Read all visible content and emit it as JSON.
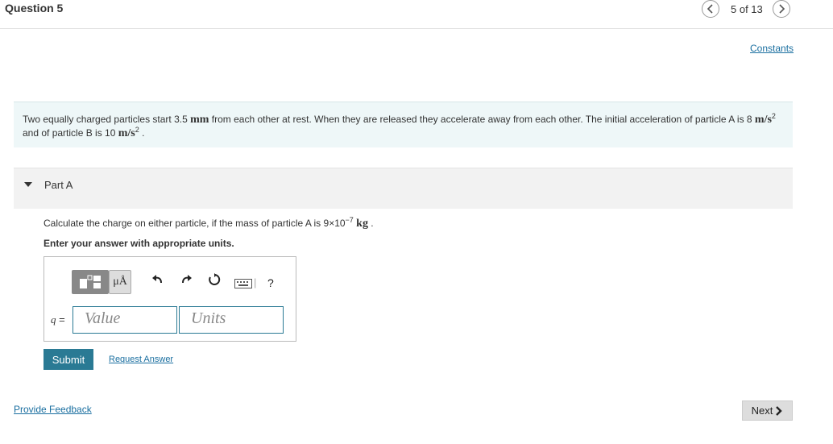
{
  "header": {
    "question_title": "Question 5",
    "position": "5 of 13",
    "prev_icon": "chevron-left-icon",
    "next_icon": "chevron-right-icon"
  },
  "constants_link": "Constants",
  "problem": {
    "text_1": "Two equally charged particles start 3.5 ",
    "unit_mm": "mm",
    "text_2": " from each other at rest. When they are released they accelerate away from each other. The initial acceleration of particle A is 8 ",
    "unit_a1": "m/s",
    "exp_a1": "2",
    "text_3": " and of particle B is 10 ",
    "unit_b1": "m/s",
    "exp_b1": "2",
    "text_4": " ."
  },
  "part": {
    "label": "Part A",
    "question_1": "Calculate the charge on either particle, if the mass of particle A is 9×10",
    "question_exp": "−7",
    "question_unit": "kg",
    "question_end": " .",
    "instruction": "Enter your answer with appropriate units."
  },
  "toolbar": {
    "templates_icon": "templates-icon",
    "units_label": "μÅ",
    "undo_icon": "undo-icon",
    "redo_icon": "redo-icon",
    "reset_icon": "reset-icon",
    "keyboard_icon": "keyboard-icon",
    "help_label": "?"
  },
  "answer": {
    "variable": "q",
    "equals": " =",
    "value_placeholder": "Value",
    "units_placeholder": "Units"
  },
  "actions": {
    "submit": "Submit",
    "request": "Request Answer"
  },
  "footer": {
    "feedback": "Provide Feedback",
    "next": "Next"
  },
  "colors": {
    "accent": "#2a7a94",
    "link": "#1a6fa0",
    "problem_bg": "#eef7f8"
  }
}
